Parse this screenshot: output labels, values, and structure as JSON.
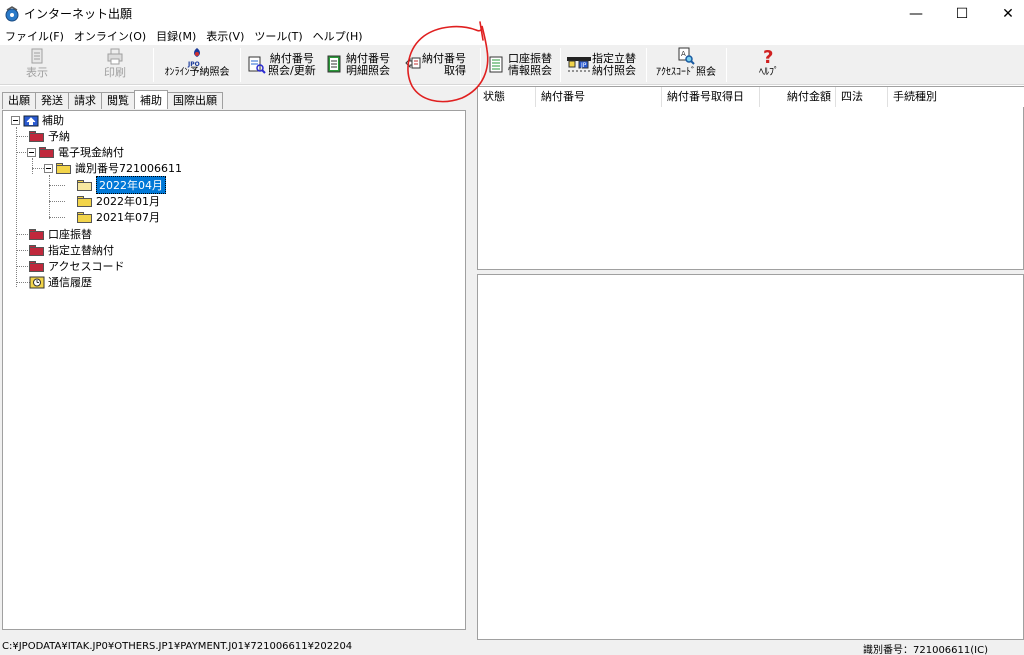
{
  "window": {
    "title": "インターネット出願",
    "min_glyph": "—",
    "max_glyph": "☐",
    "close_glyph": "✕"
  },
  "menu": [
    {
      "label": "ファイル(F)"
    },
    {
      "label": "オンライン(O)"
    },
    {
      "label": "目録(M)"
    },
    {
      "label": "表示(V)"
    },
    {
      "label": "ツール(T)"
    },
    {
      "label": "ヘルプ(H)"
    }
  ],
  "toolbar": {
    "display": "表示",
    "print": "印刷",
    "online_payment_query": "ｵﾝﾗｲﾝ予納照会",
    "payment_number_query_l1": "納付番号",
    "payment_number_query_l2": "照会/更新",
    "payment_number_detail_l1": "納付番号",
    "payment_number_detail_l2": "明細照会",
    "payment_number_acquire_l1": "納付番号",
    "payment_number_acquire_l2": "取得",
    "account_transfer_l1": "口座振替",
    "account_transfer_l2": "情報照会",
    "designated_payment_l1": "指定立替",
    "designated_payment_l2": "納付照会",
    "access_code_query": "ｱｸｾｽｺｰﾄﾞ照会",
    "help": "ﾍﾙﾌﾟ",
    "jpo_badge": "JPO"
  },
  "tabs": [
    {
      "label": "出願",
      "active": false
    },
    {
      "label": "発送",
      "active": false
    },
    {
      "label": "請求",
      "active": false
    },
    {
      "label": "閲覧",
      "active": false
    },
    {
      "label": "補助",
      "active": true
    },
    {
      "label": "国際出願",
      "active": false
    }
  ],
  "tree": {
    "root": "補助",
    "reserve": "予納",
    "electronic_cash": "電子現金納付",
    "id_number": "識別番号721006611",
    "month_1": "2022年04月",
    "month_2": "2022年01月",
    "month_3": "2021年07月",
    "account_transfer": "口座振替",
    "designated_payment": "指定立替納付",
    "access_code": "アクセスコード",
    "comm_history": "通信履歴"
  },
  "list_columns": [
    {
      "label": "状態"
    },
    {
      "label": "納付番号"
    },
    {
      "label": "納付番号取得日"
    },
    {
      "label": "納付金額"
    },
    {
      "label": "四法"
    },
    {
      "label": "手続種別"
    }
  ],
  "status": {
    "path": "C:¥JPODATA¥ITAK.JP0¥OTHERS.JP1¥PAYMENT.J01¥721006611¥202204",
    "id": "識別番号：721006611(IC)"
  },
  "colors": {
    "accent": "#0078d7",
    "annotation": "#e02020",
    "folder_red": "#c0283c",
    "folder_yellow": "#f2d44a"
  }
}
